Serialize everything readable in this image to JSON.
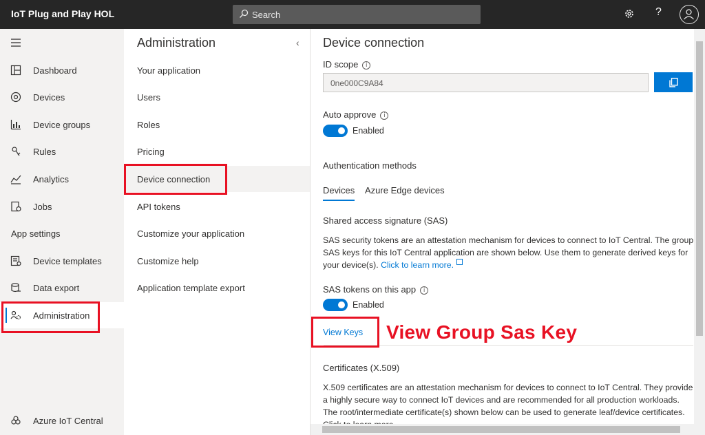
{
  "topbar": {
    "app_title": "IoT Plug and Play HOL",
    "search_placeholder": "Search"
  },
  "nav": {
    "items": [
      {
        "label": "Dashboard",
        "icon": "dashboard-icon"
      },
      {
        "label": "Devices",
        "icon": "devices-icon"
      },
      {
        "label": "Device groups",
        "icon": "device-groups-icon"
      },
      {
        "label": "Rules",
        "icon": "rules-icon"
      },
      {
        "label": "Analytics",
        "icon": "analytics-icon"
      },
      {
        "label": "Jobs",
        "icon": "jobs-icon"
      }
    ],
    "section_title": "App settings",
    "settings_items": [
      {
        "label": "Device templates",
        "icon": "device-templates-icon"
      },
      {
        "label": "Data export",
        "icon": "data-export-icon"
      },
      {
        "label": "Administration",
        "icon": "administration-icon"
      }
    ],
    "footer_label": "Azure IoT Central"
  },
  "sub": {
    "title": "Administration",
    "items": [
      "Your application",
      "Users",
      "Roles",
      "Pricing",
      "Device connection",
      "API tokens",
      "Customize your application",
      "Customize help",
      "Application template export"
    ]
  },
  "main": {
    "title": "Device connection",
    "id_scope_label": "ID scope",
    "id_scope_value": "0ne000C9A84",
    "auto_approve_label": "Auto approve",
    "auto_approve_state": "Enabled",
    "auth_methods_label": "Authentication methods",
    "tabs": [
      "Devices",
      "Azure Edge devices"
    ],
    "sas_heading": "Shared access signature (SAS)",
    "sas_desc": "SAS security tokens are an attestation mechanism for devices to connect to IoT Central. The group SAS keys for this IoT Central application are shown below. Use them to generate derived keys for your device(s).",
    "sas_link": "Click to learn more.",
    "sas_tokens_label": "SAS tokens on this app",
    "sas_tokens_state": "Enabled",
    "view_keys": "View Keys",
    "callout": "View Group Sas Key",
    "cert_heading": "Certificates (X.509)",
    "cert_desc": "X.509 certificates are an attestation mechanism for devices to connect to IoT Central. They provide a highly secure way to connect IoT devices and are recommended for all production workloads. The root/intermediate certificate(s) shown below can be used to generate leaf/device certificates. Click to learn more."
  },
  "colors": {
    "accent": "#0078d4",
    "highlight": "#e81123",
    "topbar": "#262626"
  }
}
